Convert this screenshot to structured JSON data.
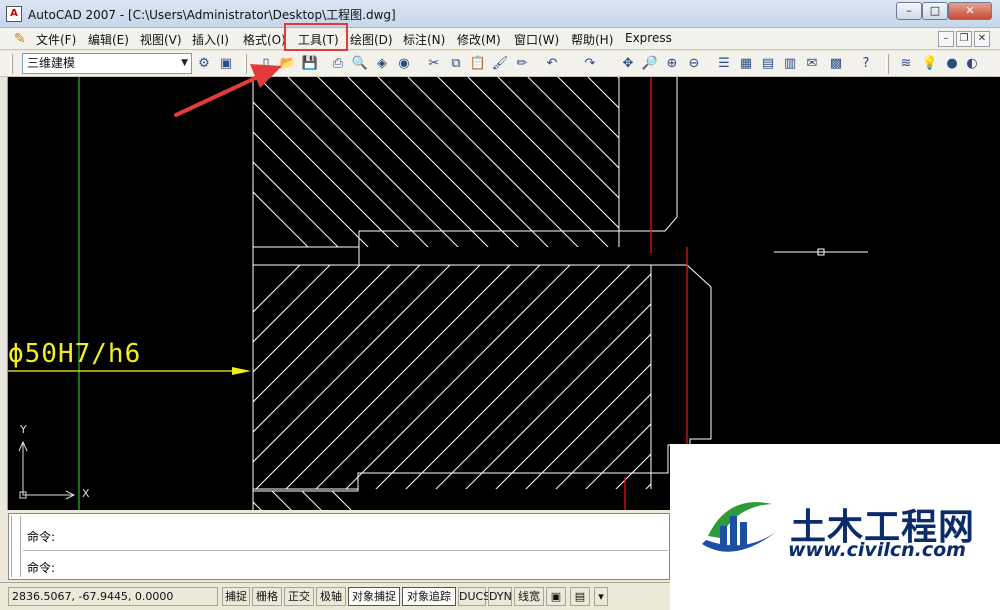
{
  "window": {
    "title": "AutoCAD 2007 - [C:\\Users\\Administrator\\Desktop\\工程图.dwg]",
    "icon_text": "A",
    "controls": {
      "minimize": "–",
      "maximize": "□",
      "close": "✕"
    }
  },
  "menubar": {
    "items": [
      "文件(F)",
      "编辑(E)",
      "视图(V)",
      "插入(I)",
      "格式(O)",
      "工具(T)",
      "绘图(D)",
      "标注(N)",
      "修改(M)",
      "窗口(W)",
      "帮助(H)",
      "Express"
    ],
    "highlighted": "工具(T)",
    "mdi_controls": {
      "minimize": "–",
      "restore": "❐",
      "close": "✕"
    }
  },
  "toolbar": {
    "workspace": "三维建模",
    "icons": [
      "workspace-settings-icon",
      "workspace-save-icon",
      "new-file-icon",
      "open-file-icon",
      "save-file-icon",
      "plot-icon",
      "plot-preview-icon",
      "publish-icon",
      "3d-dwf-icon",
      "cut-icon",
      "copy-icon",
      "paste-icon",
      "match-properties-icon",
      "block-editor-icon",
      "undo-icon",
      "redo-icon",
      "pan-icon",
      "zoom-realtime-icon",
      "zoom-window-icon",
      "zoom-previous-icon",
      "properties-icon",
      "design-center-icon",
      "tool-palettes-icon",
      "sheet-set-icon",
      "markup-icon",
      "quickcalc-icon",
      "help-icon",
      "layer-icon",
      "layer-bulb-icon"
    ]
  },
  "canvas": {
    "dimension_text": "ϕ50H7/h6",
    "ucs": {
      "y_label": "Y",
      "x_label": "X"
    },
    "colors": {
      "background": "#000000",
      "geometry": "#ffffff",
      "centerline_red": "#e01414",
      "axis_green": "#19c419",
      "dimension_yellow": "#f2ef1a"
    }
  },
  "command": {
    "line1": "命令:",
    "line2": "命令:"
  },
  "statusbar": {
    "coordinates": "2836.5067, -67.9445, 0.0000",
    "buttons": [
      "捕捉",
      "栅格",
      "正交",
      "极轴",
      "对象捕捉",
      "对象追踪",
      "DUCS",
      "DYN",
      "线宽"
    ],
    "active": [
      "对象捕捉",
      "对象追踪"
    ]
  },
  "watermark": {
    "name": "土木工程网",
    "url": "www.civilcn.com"
  },
  "annotation": {
    "arrow_color": "#e23b3b",
    "box_color": "#e23b3b"
  }
}
